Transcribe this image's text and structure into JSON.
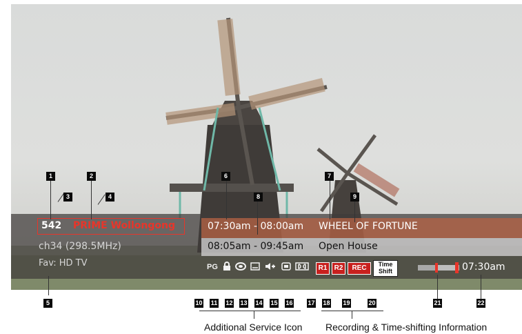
{
  "channel": {
    "number": "542",
    "name": "PRIME Wollongong",
    "frequency": "ch34 (298.5MHz)",
    "favourite": "Fav: HD TV"
  },
  "programs": [
    {
      "time": "07:30am - 08:00am",
      "title": "WHEEL OF FORTUNE"
    },
    {
      "time": "08:05am - 09:45am",
      "title": "Open House"
    }
  ],
  "service_icons": {
    "rating": "PG",
    "lock": "lock-icon",
    "subtitle": "subtitle-icon",
    "teletext": "teletext-icon",
    "audio": "audio-icon",
    "screen": "screen-format-icon",
    "dolby": "dolby-icon"
  },
  "recording": {
    "r1": "R1",
    "r2": "R2",
    "rec": "REC",
    "timeshift_line1": "Time",
    "timeshift_line2": "Shift"
  },
  "timeshift_progress": 0.45,
  "clock": "07:30am",
  "markers": [
    "1",
    "2",
    "3",
    "4",
    "5",
    "6",
    "7",
    "8",
    "9",
    "10",
    "11",
    "12",
    "13",
    "14",
    "15",
    "16",
    "17",
    "18",
    "19",
    "20",
    "21",
    "22"
  ],
  "captions": {
    "service": "Additional Service Icon",
    "recording": "Recording & Time-shifting Information"
  },
  "colors": {
    "channel_name": "#e8352a",
    "banner": "#403c3a",
    "current_program": "#b26244",
    "next_program": "#cdcdcd",
    "record_badge": "#c8201e"
  }
}
